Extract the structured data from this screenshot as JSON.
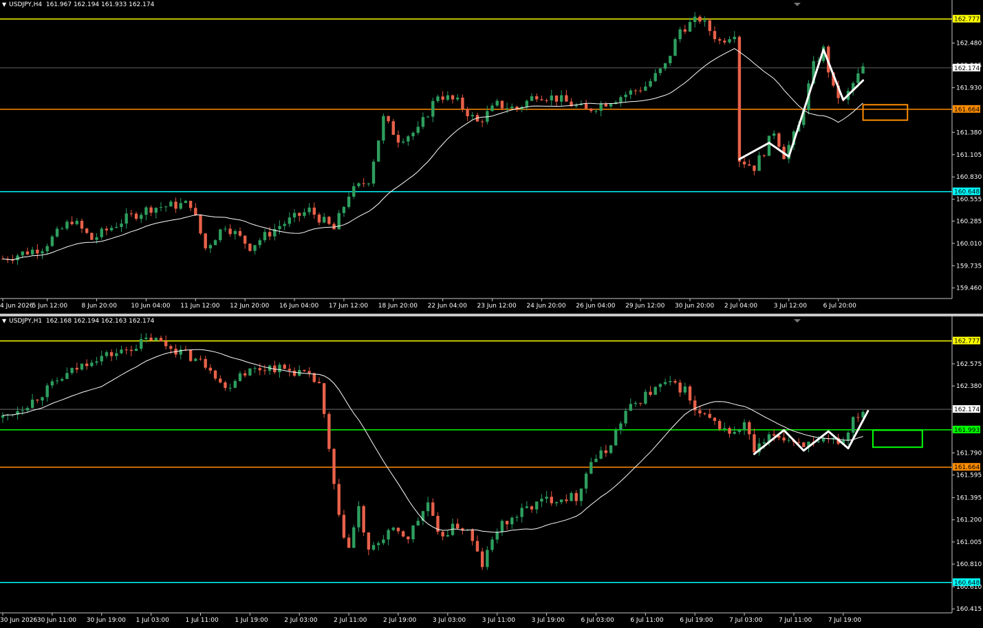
{
  "panes": [
    {
      "id": "h4",
      "symbol": "USDJPY,H4",
      "ohlc": "161.967 162.194 161.933 162.174",
      "chart_data": {
        "type": "candlestick",
        "ylim": [
          159.33,
          162.91
        ],
        "price_ticks": [
          "162.480",
          "162.205",
          "161.930",
          "161.380",
          "161.105",
          "160.830",
          "160.555",
          "160.285",
          "160.010",
          "159.735",
          "159.460"
        ],
        "time_labels": [
          {
            "label": "4 Jun 2026",
            "i": 0
          },
          {
            "label": "5 Jun 12:00",
            "i": 9
          },
          {
            "label": "8 Jun 20:00",
            "i": 19
          },
          {
            "label": "10 Jun 04:00",
            "i": 29
          },
          {
            "label": "11 Jun 12:00",
            "i": 39
          },
          {
            "label": "12 Jun 20:00",
            "i": 49
          },
          {
            "label": "16 Jun 04:00",
            "i": 59
          },
          {
            "label": "17 Jun 12:00",
            "i": 69
          },
          {
            "label": "18 Jun 20:00",
            "i": 79
          },
          {
            "label": "22 Jun 04:00",
            "i": 89
          },
          {
            "label": "23 Jun 12:00",
            "i": 99
          },
          {
            "label": "24 Jun 20:00",
            "i": 109
          },
          {
            "label": "26 Jun 04:00",
            "i": 119
          },
          {
            "label": "29 Jun 12:00",
            "i": 129
          },
          {
            "label": "30 Jun 20:00",
            "i": 139
          },
          {
            "label": "2 Jul 04:00",
            "i": 149
          },
          {
            "label": "3 Jul 12:00",
            "i": 159
          },
          {
            "label": "6 Jul 20:00",
            "i": 169
          }
        ],
        "levels": [
          {
            "price": 162.777,
            "label": "162.777",
            "color": "#ffff00",
            "boxText": "#000"
          },
          {
            "price": 162.174,
            "label": "162.174",
            "color": "#808080",
            "boxText": "#000",
            "boxBg": "#ffffff",
            "thin": true
          },
          {
            "price": 161.664,
            "label": "161.664",
            "color": "#ff8c00",
            "boxText": "#000"
          },
          {
            "price": 160.648,
            "label": "160.648",
            "color": "#00ffff",
            "boxText": "#000"
          }
        ],
        "anchors": [
          [
            0,
            159.82
          ],
          [
            8,
            159.96
          ],
          [
            14,
            160.3
          ],
          [
            18,
            160.06
          ],
          [
            25,
            160.32
          ],
          [
            30,
            160.45
          ],
          [
            38,
            160.5
          ],
          [
            41,
            159.95
          ],
          [
            45,
            160.24
          ],
          [
            50,
            159.97
          ],
          [
            56,
            160.23
          ],
          [
            62,
            160.42
          ],
          [
            67,
            160.18
          ],
          [
            70,
            160.62
          ],
          [
            74,
            160.8
          ],
          [
            77,
            161.55
          ],
          [
            80,
            161.3
          ],
          [
            84,
            161.4
          ],
          [
            88,
            161.85
          ],
          [
            92,
            161.75
          ],
          [
            96,
            161.5
          ],
          [
            100,
            161.72
          ],
          [
            104,
            161.67
          ],
          [
            108,
            161.85
          ],
          [
            112,
            161.8
          ],
          [
            118,
            161.65
          ],
          [
            124,
            161.8
          ],
          [
            130,
            161.95
          ],
          [
            134,
            162.2
          ],
          [
            137,
            162.65
          ],
          [
            141,
            162.78
          ],
          [
            145,
            162.5
          ],
          [
            148,
            162.62
          ],
          [
            149,
            161.05
          ],
          [
            152,
            160.95
          ],
          [
            154,
            161.15
          ],
          [
            156,
            161.4
          ],
          [
            158,
            161.1
          ],
          [
            161,
            161.45
          ],
          [
            164,
            162.2
          ],
          [
            166,
            162.4
          ],
          [
            168,
            161.9
          ],
          [
            170,
            161.75
          ],
          [
            172,
            161.98
          ],
          [
            174,
            162.17
          ]
        ],
        "count": 175,
        "seed": 7,
        "ma": {
          "period": 21,
          "color": "#ffffff"
        },
        "zigzag": [
          [
            149,
            161.05
          ],
          [
            155,
            161.25
          ],
          [
            159,
            161.08
          ],
          [
            166,
            162.4
          ],
          [
            170,
            161.78
          ],
          [
            174,
            162.02
          ]
        ],
        "box": {
          "i0": 174,
          "i1": 183,
          "p0": 161.53,
          "p1": 161.72,
          "color": "#ff8c00"
        }
      }
    },
    {
      "id": "h1",
      "symbol": "USDJPY,H1",
      "ohlc": "162.168 162.194 162.163 162.174",
      "chart_data": {
        "type": "candlestick",
        "ylim": [
          160.38,
          162.92
        ],
        "price_ticks": [
          "162.575",
          "162.380",
          "161.790",
          "161.595",
          "161.395",
          "161.200",
          "161.005",
          "160.810",
          "160.610",
          "160.415"
        ],
        "time_labels": [
          {
            "label": "30 Jun 2026",
            "i": 0
          },
          {
            "label": "30 Jun 11:00",
            "i": 10
          },
          {
            "label": "30 Jun 19:00",
            "i": 20
          },
          {
            "label": "1 Jul 03:00",
            "i": 30
          },
          {
            "label": "1 Jul 11:00",
            "i": 40
          },
          {
            "label": "1 Jul 19:00",
            "i": 50
          },
          {
            "label": "2 Jul 03:00",
            "i": 60
          },
          {
            "label": "2 Jul 11:00",
            "i": 70
          },
          {
            "label": "2 Jul 19:00",
            "i": 80
          },
          {
            "label": "3 Jul 03:00",
            "i": 90
          },
          {
            "label": "3 Jul 11:00",
            "i": 100
          },
          {
            "label": "3 Jul 19:00",
            "i": 110
          },
          {
            "label": "6 Jul 03:00",
            "i": 120
          },
          {
            "label": "6 Jul 11:00",
            "i": 130
          },
          {
            "label": "6 Jul 19:00",
            "i": 140
          },
          {
            "label": "7 Jul 03:00",
            "i": 150
          },
          {
            "label": "7 Jul 11:00",
            "i": 160
          },
          {
            "label": "7 Jul 19:00",
            "i": 170
          }
        ],
        "levels": [
          {
            "price": 162.777,
            "label": "162.777",
            "color": "#ffff00",
            "boxText": "#000"
          },
          {
            "price": 162.174,
            "label": "162.174",
            "color": "#808080",
            "boxText": "#000",
            "boxBg": "#ffffff",
            "thin": true
          },
          {
            "price": 161.993,
            "label": "161.993",
            "color": "#00ff00",
            "boxText": "#000"
          },
          {
            "price": 161.664,
            "label": "161.664",
            "color": "#ff8c00",
            "boxText": "#000"
          }
        ],
        "levelExtra": {
          "price": 160.648,
          "label": "160.648",
          "color": "#00ffff",
          "boxText": "#000"
        },
        "anchors": [
          [
            0,
            162.1
          ],
          [
            6,
            162.25
          ],
          [
            12,
            162.45
          ],
          [
            18,
            162.62
          ],
          [
            24,
            162.68
          ],
          [
            30,
            162.8
          ],
          [
            36,
            162.68
          ],
          [
            42,
            162.55
          ],
          [
            45,
            162.35
          ],
          [
            48,
            162.5
          ],
          [
            54,
            162.55
          ],
          [
            60,
            162.5
          ],
          [
            64,
            162.4
          ],
          [
            66,
            161.8
          ],
          [
            68,
            161.2
          ],
          [
            70,
            160.95
          ],
          [
            72,
            161.3
          ],
          [
            74,
            160.9
          ],
          [
            78,
            161.1
          ],
          [
            82,
            161.05
          ],
          [
            86,
            161.35
          ],
          [
            88,
            161.05
          ],
          [
            92,
            161.15
          ],
          [
            94,
            161.1
          ],
          [
            97,
            160.8
          ],
          [
            100,
            161.12
          ],
          [
            106,
            161.3
          ],
          [
            110,
            161.38
          ],
          [
            114,
            161.4
          ],
          [
            116,
            161.4
          ],
          [
            119,
            161.72
          ],
          [
            122,
            161.8
          ],
          [
            126,
            162.15
          ],
          [
            130,
            162.3
          ],
          [
            134,
            162.4
          ],
          [
            138,
            162.35
          ],
          [
            140,
            162.15
          ],
          [
            144,
            162.05
          ],
          [
            148,
            161.95
          ],
          [
            150,
            162.05
          ],
          [
            152,
            161.8
          ],
          [
            156,
            161.95
          ],
          [
            160,
            161.9
          ],
          [
            164,
            161.85
          ],
          [
            168,
            161.9
          ],
          [
            170,
            161.9
          ],
          [
            172,
            162.1
          ],
          [
            174,
            162.17
          ]
        ],
        "count": 175,
        "seed": 13,
        "ma": {
          "period": 21,
          "color": "#ffffff"
        },
        "zigzag": [
          [
            152,
            161.78
          ],
          [
            158,
            161.99
          ],
          [
            162,
            161.81
          ],
          [
            167,
            161.98
          ],
          [
            171,
            161.83
          ],
          [
            175,
            162.16
          ]
        ],
        "box": {
          "i0": 176,
          "i1": 186,
          "p0": 161.84,
          "p1": 161.99,
          "color": "#00ff00"
        }
      }
    }
  ]
}
